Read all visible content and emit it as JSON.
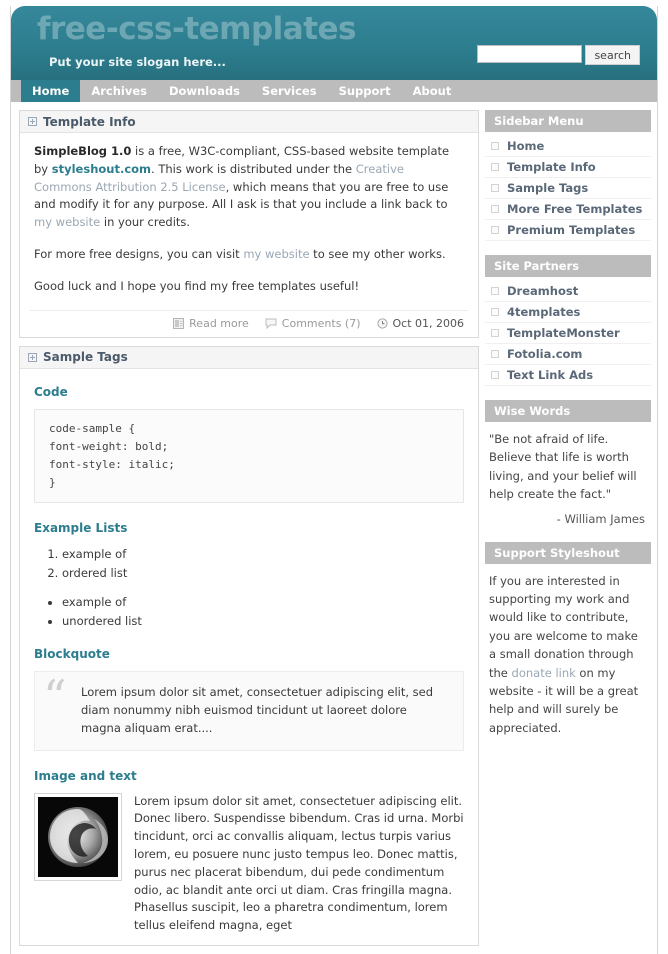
{
  "header": {
    "logo": "free-css-templates",
    "slogan": "Put your site slogan here...",
    "search_value": "",
    "search_placeholder": "",
    "search_button": "search"
  },
  "nav": {
    "items": [
      {
        "label": "Home",
        "active": true
      },
      {
        "label": "Archives",
        "active": false
      },
      {
        "label": "Downloads",
        "active": false
      },
      {
        "label": "Services",
        "active": false
      },
      {
        "label": "Support",
        "active": false
      },
      {
        "label": "About",
        "active": false
      }
    ]
  },
  "posts": {
    "template_info": {
      "title": "Template Info",
      "p1_a": "SimpleBlog 1.0",
      "p1_b": " is a free, W3C-compliant, CSS-based website template by ",
      "p1_link1": "styleshout.com",
      "p1_c": ". This work is distributed under the ",
      "p1_link2": "Creative Commons Attribution 2.5 License",
      "p1_d": ", which means that you are free to use and modify it for any purpose. All I ask is that you include a link back to ",
      "p1_link3": "my website",
      "p1_e": " in your credits.",
      "p2_a": "For more free designs, you can visit ",
      "p2_link": "my website",
      "p2_b": " to see my other works.",
      "p3": "Good luck and I hope you find my free templates useful!",
      "meta": {
        "read_more": "Read more",
        "comments": "Comments (7)",
        "date": "Oct 01, 2006"
      }
    },
    "sample_tags": {
      "title": "Sample Tags",
      "code_heading": "Code",
      "code_text": "code-sample {\nfont-weight: bold;\nfont-style: italic;\n}",
      "lists_heading": "Example Lists",
      "ordered": [
        "example of",
        "ordered list"
      ],
      "unordered": [
        "example of",
        "unordered list"
      ],
      "blockquote_heading": "Blockquote",
      "blockquote_text": "Lorem ipsum dolor sit amet, consectetuer adipiscing elit, sed diam nonummy nibh euismod tincidunt ut laoreet dolore magna aliquam erat....",
      "image_heading": "Image and text",
      "image_text": "Lorem ipsum dolor sit amet, consectetuer adipiscing elit. Donec libero. Suspendisse bibendum. Cras id urna. Morbi tincidunt, orci ac convallis aliquam, lectus turpis varius lorem, eu posuere nunc justo tempus leo. Donec mattis, purus nec placerat bibendum, dui pede condimentum odio, ac blandit ante orci ut diam. Cras fringilla magna. Phasellus suscipit, leo a pharetra condimentum, lorem tellus eleifend magna, eget"
    }
  },
  "sidebar": {
    "menu": {
      "title": "Sidebar Menu",
      "items": [
        "Home",
        "Template Info",
        "Sample Tags",
        "More Free Templates",
        "Premium Templates"
      ]
    },
    "partners": {
      "title": "Site Partners",
      "items": [
        "Dreamhost",
        "4templates",
        "TemplateMonster",
        "Fotolia.com",
        "Text Link Ads"
      ]
    },
    "wise": {
      "title": "Wise Words",
      "quote": "\"Be not afraid of life. Believe that life is worth living, and your belief will help create the fact.\"",
      "attribution": "- William James"
    },
    "support": {
      "title": "Support Styleshout",
      "text_a": "If you are interested in supporting my work and would like to contribute, you are welcome to make a small donation through the ",
      "link": "donate link",
      "text_b": " on my website - it will be a great help and will surely be appreciated."
    }
  },
  "colors": {
    "brand_teal": "#2c7d8e",
    "nav_gray": "#bcbcbc",
    "link_gray": "#9aa7b4",
    "heading_blue": "#4a5a6a"
  }
}
